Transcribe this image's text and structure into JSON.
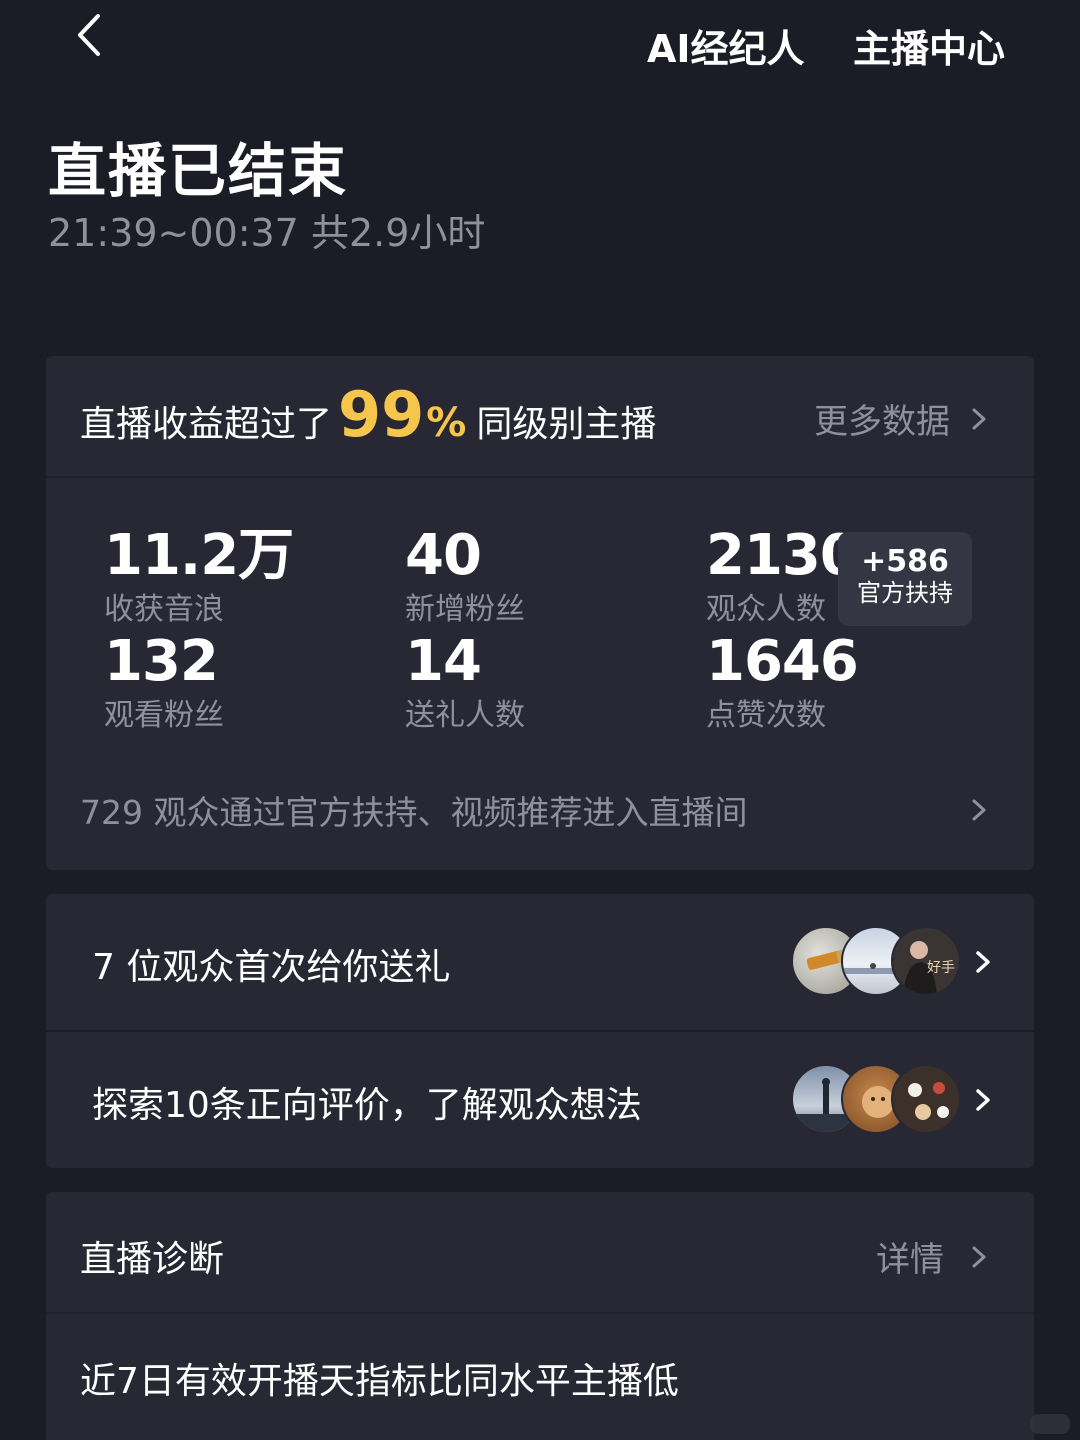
{
  "header": {
    "ai_agent_label": "AI经纪人",
    "anchor_center_label": "主播中心"
  },
  "title": "直播已结束",
  "subtitle": "21:39~00:37 共2.9小时",
  "earnings": {
    "prefix": "直播收益超过了",
    "percent_value": "99",
    "percent_sign": "%",
    "suffix": "同级别主播",
    "more_label": "更多数据"
  },
  "stats": [
    {
      "value": "11.2万",
      "label": "收获音浪"
    },
    {
      "value": "40",
      "label": "新增粉丝"
    },
    {
      "value": "2130",
      "label": "观众人数"
    },
    {
      "value": "132",
      "label": "观看粉丝"
    },
    {
      "value": "14",
      "label": "送礼人数"
    },
    {
      "value": "1646",
      "label": "点赞次数"
    }
  ],
  "official_support": {
    "value": "+586",
    "label": "官方扶持"
  },
  "viewer_source_text": "729 观众通过官方扶持、视频推荐进入直播间",
  "gift_row": {
    "text": "7 位观众首次给你送礼"
  },
  "review_row": {
    "text": "探索10条正向评价，了解观众想法"
  },
  "diagnosis": {
    "title": "直播诊断",
    "detail_label": "详情",
    "text": "近7日有效开播天指标比同水平主播低"
  },
  "colors": {
    "background": "#1b1c25",
    "card": "#272833",
    "accent": "#f6c64c",
    "muted_text": "#8e909b"
  },
  "icons": [
    "back-arrow-icon",
    "chevron-right-icon"
  ]
}
